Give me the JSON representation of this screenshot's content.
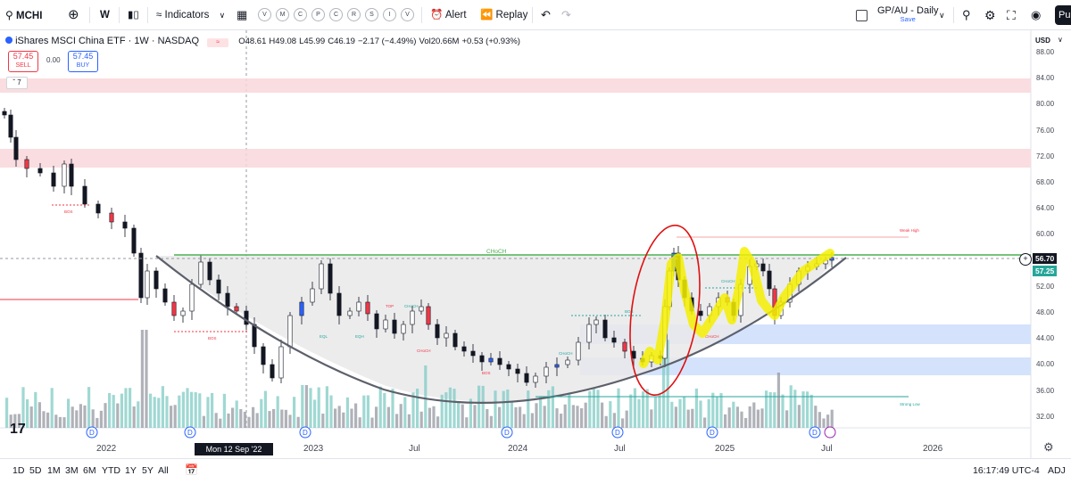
{
  "toolbar": {
    "symbol": "MCHI",
    "interval": "W",
    "indicators_label": "Indicators",
    "quick_buttons": [
      "V",
      "M",
      "C",
      "P",
      "C",
      "R",
      "S",
      "I",
      "V"
    ],
    "alert_label": "Alert",
    "replay_label": "Replay",
    "layout_name": "GP/AU - Daily",
    "layout_sub": "Save",
    "publish_label": "Pu"
  },
  "legend": {
    "title": "iShares MSCI China ETF · 1W · NASDAQ",
    "open": "O48.61",
    "high": "H49.08",
    "low": "L45.99",
    "close": "C46.19",
    "change": "−2.17 (−4.49%)",
    "volume": "Vol20.66M",
    "volume_change": "+0.53 (+0.93%)",
    "sell_price": "57.45",
    "sell_label": "SELL",
    "spread": "0.00",
    "buy_price": "57.45",
    "buy_label": "BUY",
    "indicator_count": "7"
  },
  "price_axis": {
    "currency": "USD",
    "ticks": [
      "88.00",
      "84.00",
      "80.00",
      "76.00",
      "72.00",
      "68.00",
      "64.00",
      "60.00",
      "56.00",
      "52.00",
      "48.00",
      "44.00",
      "40.00",
      "36.00",
      "32.00"
    ],
    "current_price": "56.70",
    "second_price": "57.25"
  },
  "time_axis": {
    "labels": [
      "2022",
      "Jul",
      "2023",
      "Jul",
      "2024",
      "Jul",
      "2025",
      "Jul",
      "2026"
    ],
    "crosshair_label": "Mon 12 Sep '22"
  },
  "annotations": {
    "choch_top": "CHoCH",
    "weak_high": "Weak High",
    "strong_low": "Strong Low",
    "bos": "BOS",
    "choch": "CHoCH",
    "eql": "EQL",
    "eqh": "EQH",
    "top": "TOP"
  },
  "bottombar": {
    "ranges": [
      "1D",
      "5D",
      "1M",
      "3M",
      "6M",
      "YTD",
      "1Y",
      "5Y",
      "All"
    ],
    "time": "16:17:49 UTC-4",
    "adj": "ADJ"
  },
  "colors": {
    "up": "#26a69a",
    "down": "#131722",
    "blue": "#2962ff",
    "red": "#f23645",
    "green_line": "#4caf50",
    "supply": "#f8d7da",
    "demand": "#cfe0fb",
    "vol": "#80cbc4"
  }
}
